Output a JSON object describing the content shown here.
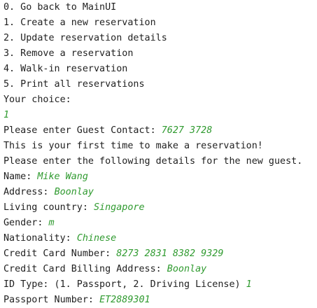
{
  "console": {
    "menu": [
      "0. Go back to MainUI",
      "1. Create a new reservation",
      "2. Update reservation details",
      "3. Remove a reservation",
      "4. Walk-in reservation",
      "5. Print all reservations"
    ],
    "choice_prompt": "Your choice:",
    "choice_input": "1",
    "guest_contact_prompt": "Please enter Guest Contact: ",
    "guest_contact_input": "7627 3728",
    "first_time_message": "This is your first time to make a reservation!",
    "details_message": "Please enter the following details for the new guest.",
    "fields": [
      {
        "prompt": "Name: ",
        "input": "Mike Wang"
      },
      {
        "prompt": "Address: ",
        "input": "Boonlay"
      },
      {
        "prompt": "Living country: ",
        "input": "Singapore"
      },
      {
        "prompt": "Gender: ",
        "input": "m"
      },
      {
        "prompt": "Nationality: ",
        "input": "Chinese"
      },
      {
        "prompt": "Credit Card Number: ",
        "input": "8273 2831 8382 9329"
      },
      {
        "prompt": "Credit Card Billing Address: ",
        "input": "Boonlay"
      },
      {
        "prompt": "ID Type: (1. Passport, 2. Driving License) ",
        "input": "1"
      },
      {
        "prompt": "Passport Number: ",
        "input": "ET2889301"
      }
    ]
  },
  "colors": {
    "text": "#1f1f1f",
    "user_input": "#2f9a2f",
    "background": "#ffffff"
  }
}
